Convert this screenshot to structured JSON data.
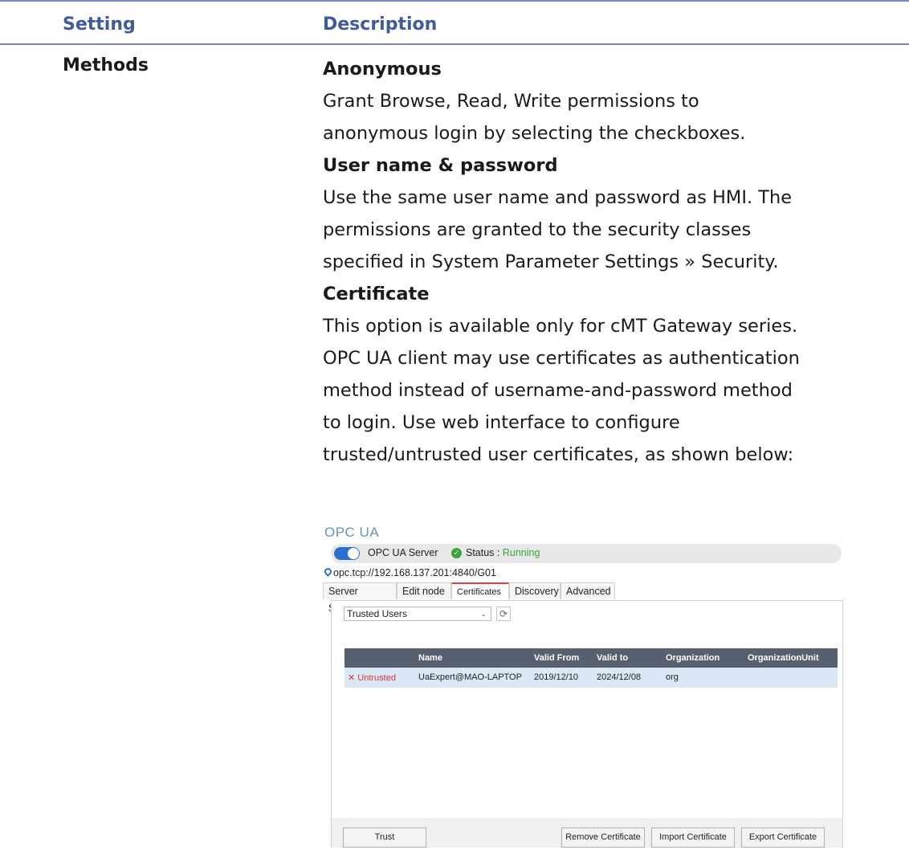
{
  "table": {
    "header_setting": "Setting",
    "header_description": "Description",
    "row": {
      "setting": "Methods",
      "lines": [
        {
          "text": "Anonymous",
          "bold": true
        },
        {
          "text": "Grant Browse, Read, Write permissions to",
          "bold": false
        },
        {
          "text": "anonymous login by selecting the checkboxes.",
          "bold": false
        },
        {
          "text": "User name & password",
          "bold": true
        },
        {
          "text": "Use the same user name and password as HMI. The",
          "bold": false
        },
        {
          "text": "permissions are granted to the security classes",
          "bold": false
        },
        {
          "text": "specified in System Parameter Settings » Security.",
          "bold": false
        },
        {
          "text": "Certificate",
          "bold": true
        },
        {
          "text": "This option is available only for cMT Gateway series.",
          "bold": false
        },
        {
          "text": "OPC UA client may use certificates as authentication",
          "bold": false
        },
        {
          "text": "method instead of username-and-password method",
          "bold": false
        },
        {
          "text": "to login. Use web interface to configure",
          "bold": false
        },
        {
          "text": "trusted/untrusted user certificates, as shown below:",
          "bold": false
        }
      ]
    }
  },
  "screenshot": {
    "title": "OPC UA",
    "server_label": "OPC UA Server",
    "status_label": "Status : ",
    "status_value": "Running",
    "url": "opc.tcp://192.168.137.201:4840/G01",
    "tabs": [
      "Server Settings",
      "Edit node",
      "Certificates",
      "Discovery",
      "Advanced"
    ],
    "active_tab": "Certificates",
    "select_value": "Trusted Users",
    "grid_columns": [
      "Name",
      "Valid From",
      "Valid to",
      "Organization",
      "OrganizationUnit"
    ],
    "grid_rows": [
      {
        "status": "Untrusted",
        "name": "UaExpert@MAO-LAPTOP",
        "valid_from": "2019/12/10",
        "valid_to": "2024/12/08",
        "organization": "org",
        "unit": ""
      }
    ],
    "buttons": {
      "trust": "Trust",
      "remove": "Remove Certificate",
      "import": "Import Certificate",
      "export": "Export Certificate"
    }
  },
  "colors": {
    "header_text": "#3f5a9e",
    "rule": "#7c86c0",
    "running": "#3aa63a",
    "untrusted": "#e03030"
  }
}
